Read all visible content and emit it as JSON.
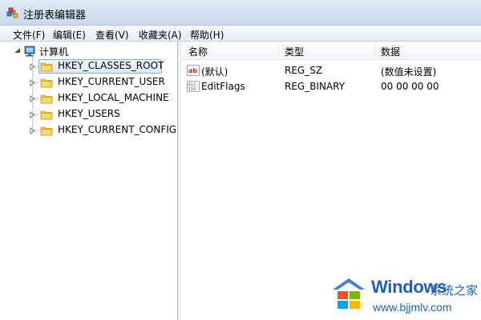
{
  "window": {
    "title": "注册表编辑器",
    "app_icon": "regedit-icon"
  },
  "menu": [
    "文件(F)",
    "编辑(E)",
    "查看(V)",
    "收藏夹(A)",
    "帮助(H)"
  ],
  "tree": {
    "root": {
      "label": "计算机",
      "icon": "computer-icon"
    },
    "keys": [
      {
        "label": "HKEY_CLASSES_ROOT",
        "selected": true
      },
      {
        "label": "HKEY_CURRENT_USER",
        "selected": false
      },
      {
        "label": "HKEY_LOCAL_MACHINE",
        "selected": false
      },
      {
        "label": "HKEY_USERS",
        "selected": false
      },
      {
        "label": "HKEY_CURRENT_CONFIG",
        "selected": false
      }
    ]
  },
  "values": {
    "columns": [
      "名称",
      "类型",
      "数据"
    ],
    "rows": [
      {
        "name": "(默认)",
        "type": "REG_SZ",
        "data": "(数值未设置)",
        "icon": "string-value-icon"
      },
      {
        "name": "EditFlags",
        "type": "REG_BINARY",
        "data": "00 00 00 00",
        "icon": "binary-value-icon"
      }
    ]
  },
  "watermark": {
    "brand": "Windows",
    "brand_cn": "系统之家",
    "url": "www.bjjmlv.com"
  },
  "colors": {
    "title_bar": "#c9daee",
    "selection_border": "#84acdd",
    "folder_yellow": "#f5c94b",
    "watermark_blue": "#1e60b8"
  }
}
